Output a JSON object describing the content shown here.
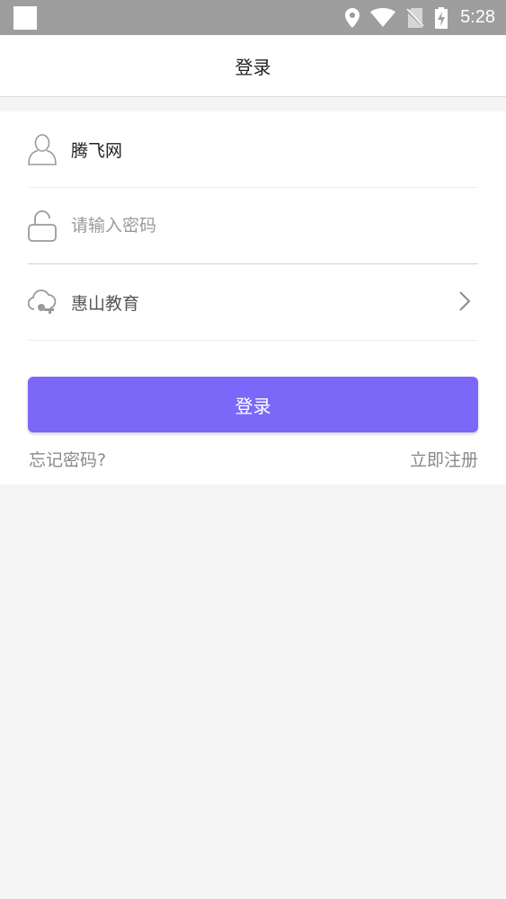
{
  "status_bar": {
    "time": "5:28",
    "icons": [
      "location-icon",
      "wifi-icon",
      "no-sim-icon",
      "battery-charging-icon"
    ]
  },
  "header": {
    "title": "登录"
  },
  "form": {
    "username_value": "腾飞网",
    "password_placeholder": "请输入密码",
    "password_value": "",
    "organization_value": "惠山教育",
    "login_button_label": "登录",
    "forgot_password_label": "忘记密码?",
    "register_label": "立即注册"
  },
  "colors": {
    "accent": "#7b68f8",
    "status_bar": "#9e9e9e",
    "background": "#f5f5f5"
  }
}
